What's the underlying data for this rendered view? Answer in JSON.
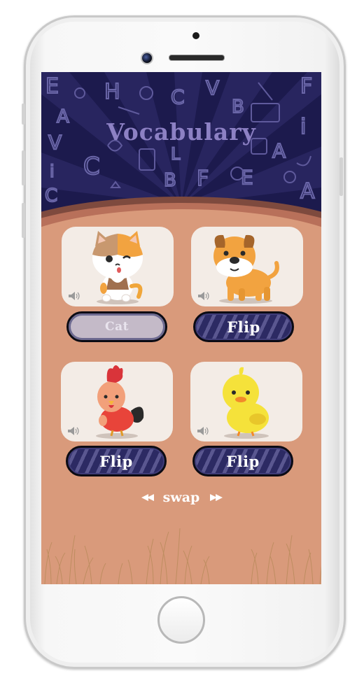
{
  "app": {
    "title": "Vocabulary"
  },
  "cards": [
    {
      "animal": "cat-icon",
      "button_label": "Cat",
      "revealed": true
    },
    {
      "animal": "dog-icon",
      "button_label": "Flip",
      "revealed": false
    },
    {
      "animal": "rooster-icon",
      "button_label": "Flip",
      "revealed": false
    },
    {
      "animal": "duck-icon",
      "button_label": "Flip",
      "revealed": false
    }
  ],
  "controls": {
    "swap_label": "swap",
    "prev_icon": "double-left-arrow-icon",
    "next_icon": "double-right-arrow-icon"
  },
  "colors": {
    "sky": "#1c1a4d",
    "ground": "#d99a7b",
    "card": "#f3ece6",
    "button": "#2c2a63",
    "title": "#8d81c4"
  }
}
